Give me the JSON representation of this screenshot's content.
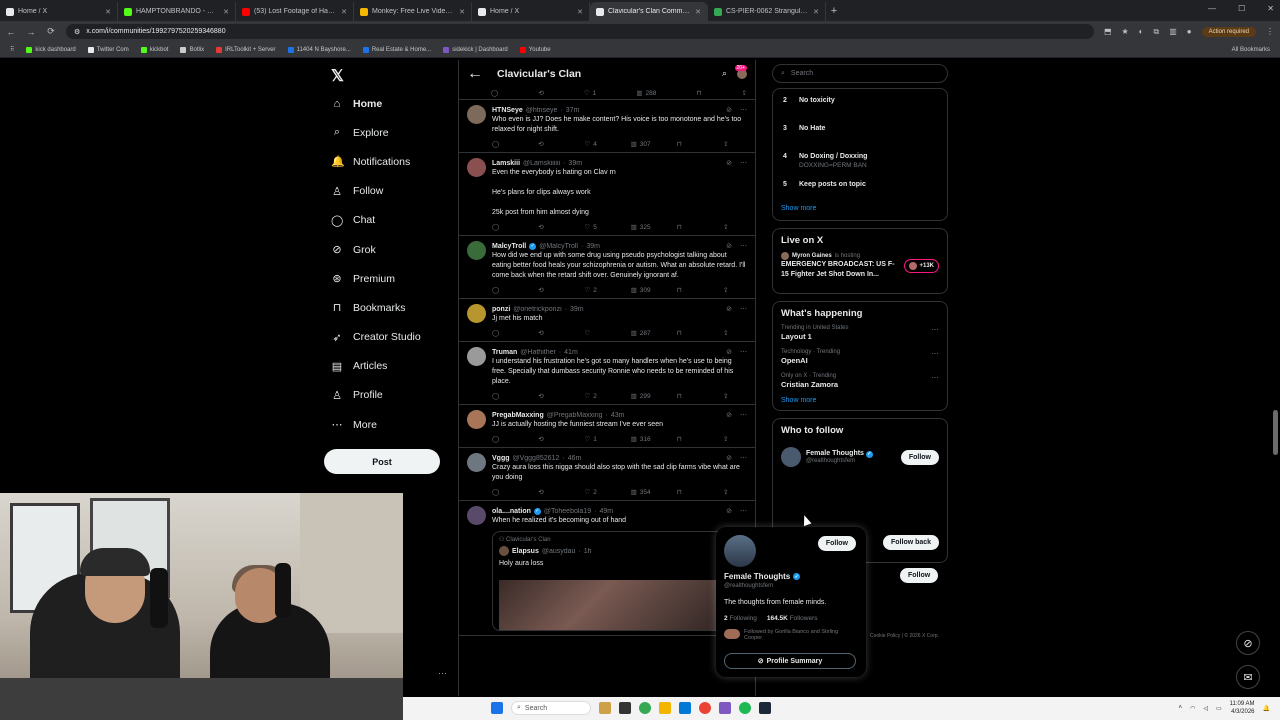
{
  "browser": {
    "tabs": [
      {
        "title": "Home / X",
        "color": "#e7e9ea",
        "active": false
      },
      {
        "title": "HAMPTONBRANDO - Watch th",
        "color": "#53fc18",
        "active": false
      },
      {
        "title": "(53) Lost Footage of Hampton",
        "color": "#ff0000",
        "active": false
      },
      {
        "title": "Monkey: Free Live Video C",
        "color": "#f5b700",
        "active": false
      },
      {
        "title": "Home / X",
        "color": "#e7e9ea",
        "active": false
      },
      {
        "title": "Clavicular's Clan Community /",
        "color": "#e7e9ea",
        "active": true
      },
      {
        "title": "CS-PIER-0062 Strangulation - I",
        "color": "#34a853",
        "active": false
      }
    ],
    "url": "x.com/i/communities/1992797520259346880",
    "action_required": "Action required",
    "bookmarks": [
      {
        "label": "kick dashboard",
        "color": "#53fc18"
      },
      {
        "label": "Twitter Com",
        "color": "#e7e9ea"
      },
      {
        "label": "kickbot",
        "color": "#53fc18"
      },
      {
        "label": "Botlix",
        "color": "#cccccc"
      },
      {
        "label": "IRLToolkit + Server",
        "color": "#e53935"
      },
      {
        "label": "11404 N Bayshore...",
        "color": "#1a73e8"
      },
      {
        "label": "Real Estate & Home...",
        "color": "#1a73e8"
      },
      {
        "label": "sidekick | Dashboard",
        "color": "#7e57c2"
      },
      {
        "label": "Youtube",
        "color": "#ff0000"
      }
    ],
    "all_bookmarks": "All Bookmarks"
  },
  "nav": {
    "items": [
      {
        "label": "Home",
        "icon": "home-icon",
        "glyph": "⌂"
      },
      {
        "label": "Explore",
        "icon": "search-icon",
        "glyph": "⌕"
      },
      {
        "label": "Notifications",
        "icon": "bell-icon",
        "glyph": "🔔"
      },
      {
        "label": "Follow",
        "icon": "person-plus-icon",
        "glyph": "♙"
      },
      {
        "label": "Chat",
        "icon": "chat-icon",
        "glyph": "◯"
      },
      {
        "label": "Grok",
        "icon": "grok-icon",
        "glyph": "⊘"
      },
      {
        "label": "Premium",
        "icon": "premium-icon",
        "glyph": "⊛"
      },
      {
        "label": "Bookmarks",
        "icon": "bookmark-icon",
        "glyph": "⊓"
      },
      {
        "label": "Creator Studio",
        "icon": "rocket-icon",
        "glyph": "➶"
      },
      {
        "label": "Articles",
        "icon": "articles-icon",
        "glyph": "▤"
      },
      {
        "label": "Profile",
        "icon": "profile-icon",
        "glyph": "♙"
      },
      {
        "label": "More",
        "icon": "more-icon",
        "glyph": "⋯"
      }
    ],
    "post_label": "Post"
  },
  "community": {
    "title": "Clavicular's Clan",
    "badge": "20+",
    "top_actions": {
      "likes": "1",
      "views": "288"
    }
  },
  "tweets": [
    {
      "name": "HTNSeye",
      "handle": "@htnseye",
      "time": "37m",
      "text": "Who even is JJ? Does he make content? His voice is too monotone and he's too relaxed for night shift.",
      "likes": "4",
      "views": "307",
      "avatar": "#7d6a5a",
      "verified": false
    },
    {
      "name": "Lamskiii",
      "handle": "@Lamskiiiiii",
      "time": "39m",
      "text": "Even the everybody is hating on Clav rn\n\nHe's plans for clips always work\n\n25k post from him almost dying",
      "likes": "5",
      "views": "325",
      "avatar": "#8a5050",
      "verified": false
    },
    {
      "name": "MalcyTroll",
      "handle": "@MalcyTroll",
      "time": "39m",
      "text": "How did we end up with some drug using pseudo psychologist talking about eating better food heals your schizophrenia or autism. What an absolute retard. I'll come back when the retard shift over. Genuinely ignorant af.",
      "likes": "2",
      "views": "309",
      "avatar": "#3a6b3a",
      "verified": true
    },
    {
      "name": "ponzi",
      "handle": "@onetrickponzi",
      "time": "39m",
      "text": "Jj met his match",
      "likes": "",
      "views": "287",
      "avatar": "#b8962e",
      "verified": false
    },
    {
      "name": "Truman",
      "handle": "@Hathither",
      "time": "41m",
      "text": "I understand his frustration he's got so many handlers when he's use to being free. Specially that dumbass security Ronnie who needs to be reminded of his place.",
      "likes": "2",
      "views": "299",
      "avatar": "#9a9a9a",
      "verified": false
    },
    {
      "name": "PregabMaxxing",
      "handle": "@PregabMaxxing",
      "time": "43m",
      "text": "JJ is actually hosting the funniest stream I've ever seen",
      "likes": "1",
      "views": "316",
      "avatar": "#a87558",
      "verified": false
    },
    {
      "name": "Vggg",
      "handle": "@Vggg852612",
      "time": "46m",
      "text": "Crazy aura loss this nigga should also stop with the sad clip farms vibe what are you doing",
      "likes": "2",
      "views": "354",
      "avatar": "#6e7780",
      "verified": false
    },
    {
      "name": "ola....nation",
      "handle": "@Toheebola19",
      "time": "49m",
      "text": "When he realized it's becoming out of hand",
      "likes": "",
      "views": "",
      "avatar": "#5a4a6a",
      "verified": true
    }
  ],
  "quote": {
    "community": "Clavicular's Clan",
    "name": "Elapsus",
    "handle": "@ausydau",
    "time": "1h",
    "text": "Holy aura loss"
  },
  "sidebar": {
    "search_placeholder": "Search",
    "rules": [
      {
        "num": "2",
        "title": "No toxicity",
        "sub": ""
      },
      {
        "num": "3",
        "title": "No Hate",
        "sub": ""
      },
      {
        "num": "4",
        "title": "No Doxing / Doxxing",
        "sub": "DOXXING=PERM BAN"
      },
      {
        "num": "5",
        "title": "Keep posts on topic",
        "sub": ""
      }
    ],
    "show_more": "Show more",
    "live": {
      "heading": "Live on X",
      "host": "Myron Gaines",
      "host_suffix": "is hosting",
      "title": "EMERGENCY BROADCAST: US F-15 Fighter Jet Shot Down In...",
      "count": "+13K"
    },
    "happening": {
      "heading": "What's happening",
      "trends": [
        {
          "context": "Trending in United States",
          "name": "Layout 1"
        },
        {
          "context": "Technology · Trending",
          "name": "OpenAI"
        },
        {
          "context": "Only on X · Trending",
          "name": "Cristian Zamora"
        }
      ],
      "show_more": "Show more"
    },
    "who": {
      "heading": "Who to follow",
      "name": "Female Thoughts",
      "handle": "@realthoughtsfem",
      "follow": "Follow",
      "follow_back": "Follow back",
      "follow3": "Follow"
    },
    "footer": "Cookie Policy | © 2026 X Corp."
  },
  "popover": {
    "name": "Female Thoughts",
    "handle": "@realthoughtsfem",
    "bio": "The thoughts from female minds.",
    "following": "2",
    "following_label": "Following",
    "followers": "164.5K",
    "followers_label": "Followers",
    "followed_by": "Followed by Gorilla Bianco and Stirling Cooper",
    "follow": "Follow",
    "summary": "Profile Summary"
  },
  "taskbar": {
    "search": "Search",
    "time": "11:09 AM",
    "date": "4/3/2026"
  }
}
